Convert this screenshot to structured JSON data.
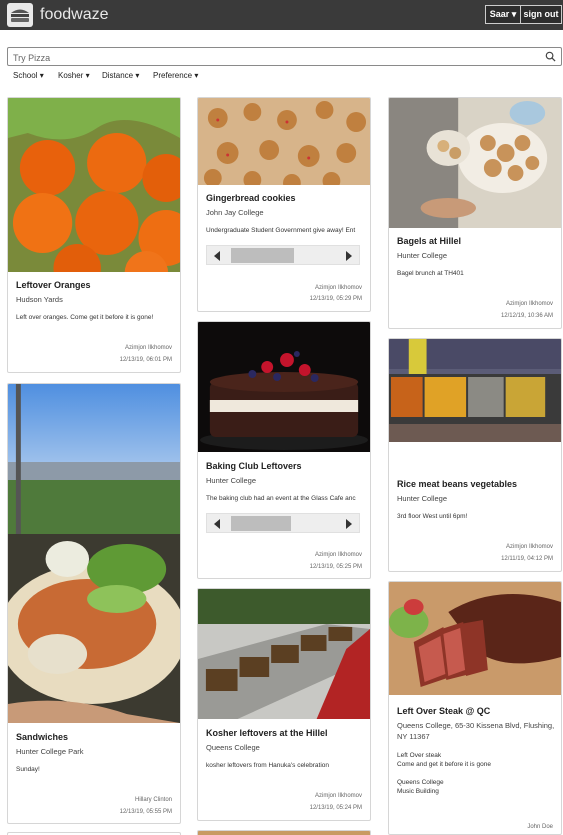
{
  "header": {
    "brand": "foodwaze",
    "user_label": "Saar",
    "signout_label": "sign out",
    "background": "#3a3a3a"
  },
  "search": {
    "placeholder": "Try Pizza",
    "value": ""
  },
  "filters": [
    {
      "label": "School"
    },
    {
      "label": "Kosher"
    },
    {
      "label": "Distance"
    },
    {
      "label": "Preference"
    }
  ],
  "cards": [
    {
      "title": "Leftover Oranges",
      "location": "Hudson Yards",
      "description": "Left over oranges. Come get it before it is gone!",
      "author": "Azimjon Ilkhomov",
      "time": "12/13/19, 06:01 PM"
    },
    {
      "title": "Gingerbread cookies",
      "location": "John Jay College",
      "description": "Undergraduate Student Government give away! Ent",
      "author": "Azimjon Ilkhomov",
      "time": "12/13/19, 05:29 PM"
    },
    {
      "title": "Bagels at Hillel",
      "location": "Hunter College",
      "description": "Bagel brunch at TH401",
      "author": "Azimjon Ilkhomov",
      "time": "12/12/19, 10:36 AM"
    },
    {
      "title": "Baking Club Leftovers",
      "location": "Hunter College",
      "description": "The baking club had an event at the Glass Cafe anc",
      "author": "Azimjon Ilkhomov",
      "time": "12/13/19, 05:25 PM"
    },
    {
      "title": "Rice meat beans vegetables",
      "location": "Hunter College",
      "description": "3rd floor West until 6pm!",
      "author": "Azimjon Ilkhomov",
      "time": "12/11/19, 04:12 PM"
    },
    {
      "title": "Sandwiches",
      "location": "Hunter College Park",
      "description": "Sunday!",
      "author": "Hillary Clinton",
      "time": "12/13/19, 05:55 PM"
    },
    {
      "title": "Kosher leftovers at the Hillel",
      "location": "Queens College",
      "description": "kosher leftovers from Hanuka's celebration",
      "author": "Azimjon Ilkhomov",
      "time": "12/13/19, 05:24 PM"
    },
    {
      "title": "Left Over Steak @ QC",
      "location": "Queens College, 65-30 Kissena Blvd, Flushing, NY 11367",
      "description": "Left Over steak\nCome and get it before it is gone\n\nQueens College\nMusic Building",
      "author": "John Doe"
    }
  ]
}
